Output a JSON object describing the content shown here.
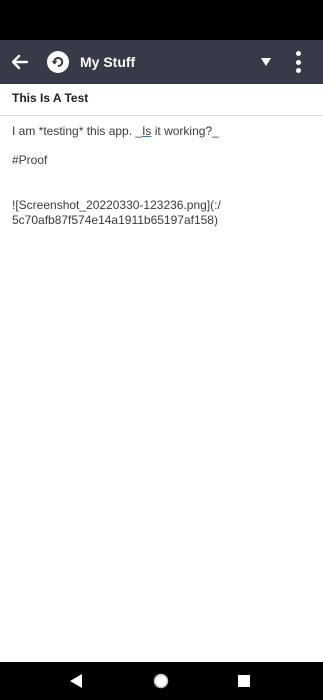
{
  "app_bar": {
    "title": "My Stuff",
    "icons": {
      "back": "arrow-left-icon",
      "sync": "sync-icon",
      "dropdown": "caret-down-icon",
      "more": "more-vert-icon"
    },
    "background": "#373a47"
  },
  "note": {
    "title": "This Is A Test",
    "body": {
      "line1_pre": "I am *testing* this app. _",
      "line1_underlined": "Is",
      "line1_post": " it working?_",
      "line2": "#Proof",
      "line3": "![Screenshot_20220330-123236.png](:/",
      "line4": "5c70afb87f574e14a1911b65197af158)"
    }
  },
  "nav_bar": {
    "icons": [
      "nav-back-icon",
      "nav-home-icon",
      "nav-recents-icon"
    ]
  }
}
